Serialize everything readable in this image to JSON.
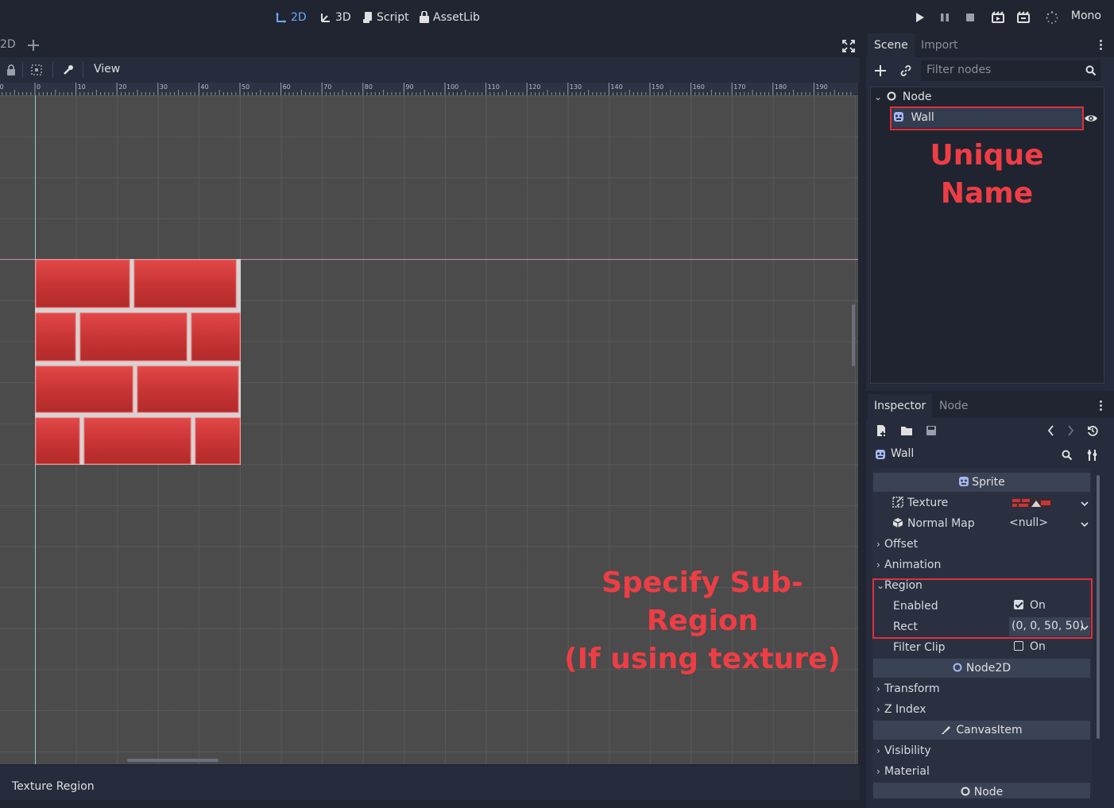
{
  "top_menu": {
    "modes": [
      {
        "label": "2D",
        "active": true
      },
      {
        "label": "3D",
        "active": false
      },
      {
        "label": "Script",
        "active": false
      },
      {
        "label": "AssetLib",
        "active": false
      }
    ],
    "build_label": "Mono"
  },
  "editor_tabs": {
    "partial_tab": "2D"
  },
  "viewport_toolbar": {
    "view_menu": "View"
  },
  "ruler": {
    "labels": [
      "10",
      "0",
      "10",
      "20",
      "30",
      "40",
      "50",
      "60",
      "70",
      "80",
      "90",
      "100",
      "110",
      "120",
      "130",
      "140",
      "150",
      "160",
      "170",
      "180",
      "190"
    ]
  },
  "bottom_panel": {
    "label": "Texture Region"
  },
  "scene_dock": {
    "tabs": [
      "Scene",
      "Import"
    ],
    "filter_placeholder": "Filter nodes",
    "tree": {
      "root": "Node",
      "child": "Wall"
    },
    "annotation": "Unique Name"
  },
  "viewport_annotation": {
    "line1": "Specify Sub-Region",
    "line2": "(If using texture)"
  },
  "inspector": {
    "tabs": [
      "Inspector",
      "Node"
    ],
    "object_name": "Wall",
    "sections": {
      "sprite": "Sprite",
      "node2d": "Node2D",
      "canvasitem": "CanvasItem",
      "node": "Node"
    },
    "properties": {
      "texture": "Texture",
      "normal_map": "Normal Map",
      "normal_map_value": "<null>",
      "offset": "Offset",
      "animation": "Animation",
      "region": "Region",
      "enabled": "Enabled",
      "enabled_value": "On",
      "rect": "Rect",
      "rect_value": "(0, 0, 50, 50)",
      "filter_clip": "Filter Clip",
      "filter_clip_value": "On",
      "transform": "Transform",
      "z_index": "Z Index",
      "visibility": "Visibility",
      "material": "Material"
    },
    "enabled_checked": true,
    "filter_clip_checked": false
  },
  "colors": {
    "accent": "#6ea8ff",
    "annotation_red": "#ee3d45",
    "brick_red": "#d43a3a",
    "mortar": "#d9d2d2"
  }
}
